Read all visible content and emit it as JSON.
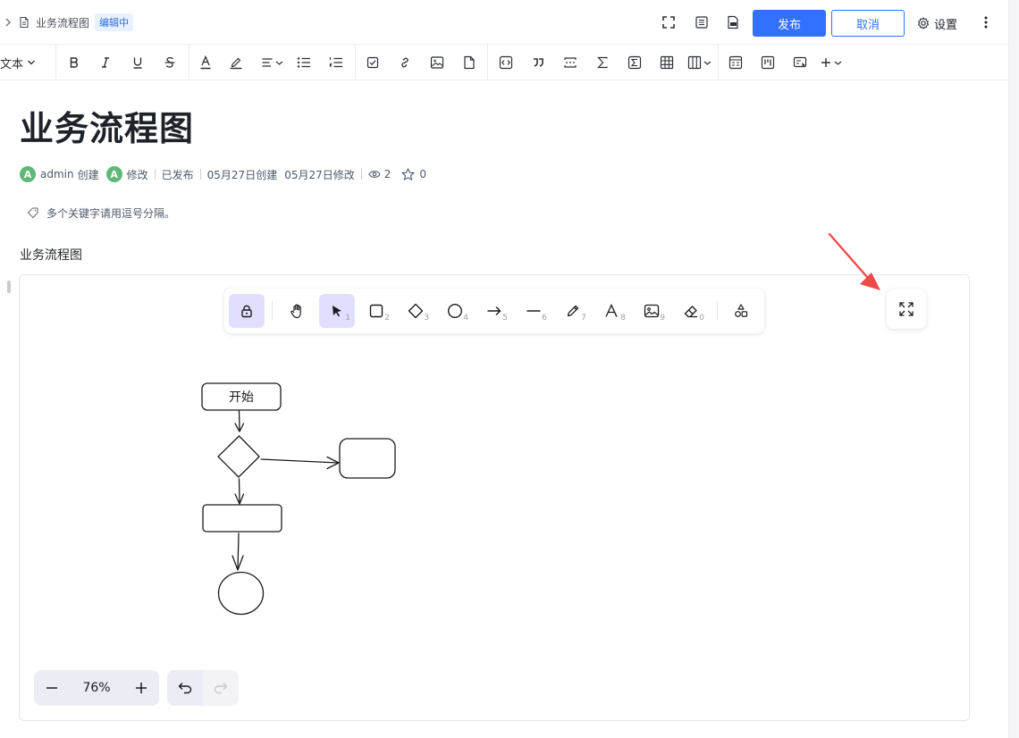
{
  "header": {
    "breadcrumb_title": "业务流程图",
    "status_badge": "编辑中",
    "publish_label": "发布",
    "cancel_label": "取消",
    "settings_label": "设置"
  },
  "toolbar": {
    "text_style_label": "文本",
    "items": [
      "bold-icon",
      "italic-icon",
      "underline-icon",
      "strikethrough-icon",
      "font-color-icon",
      "highlight-icon",
      "align-icon",
      "bullet-list-icon",
      "ordered-list-icon",
      "task-list-icon",
      "link-icon",
      "image-icon",
      "file-icon",
      "code-block-icon",
      "quote-icon",
      "divider-icon",
      "formula-icon",
      "formula-block-icon",
      "table-icon",
      "columns-icon",
      "template-icon",
      "kanban-icon",
      "embed-icon",
      "insert-more-icon"
    ]
  },
  "document": {
    "title": "业务流程图",
    "meta": {
      "avatar_letter": "A",
      "creator": "admin",
      "created_label": "创建",
      "modified_label": "修改",
      "publish_state": "已发布",
      "created_date": "05月27日创建",
      "modified_date": "05月27日修改",
      "views": "2",
      "stars": "0"
    },
    "keywords_placeholder": "多个关键字请用逗号分隔。",
    "section_label": "业务流程图"
  },
  "whiteboard": {
    "tools": [
      {
        "name": "lock-tool",
        "key": ""
      },
      {
        "name": "hand-tool",
        "key": ""
      },
      {
        "name": "select-tool",
        "key": "1"
      },
      {
        "name": "rectangle-tool",
        "key": "2"
      },
      {
        "name": "diamond-tool",
        "key": "3"
      },
      {
        "name": "ellipse-tool",
        "key": "4"
      },
      {
        "name": "arrow-tool",
        "key": "5"
      },
      {
        "name": "line-tool",
        "key": "6"
      },
      {
        "name": "pencil-tool",
        "key": "7"
      },
      {
        "name": "text-tool",
        "key": "8"
      },
      {
        "name": "image-tool",
        "key": "9"
      },
      {
        "name": "eraser-tool",
        "key": "0"
      },
      {
        "name": "shapes-library-tool",
        "key": ""
      }
    ],
    "active_tool": "select-tool",
    "zoom": "76%",
    "flowchart": {
      "start_label": "开始"
    },
    "accent_color": "#e0dfff",
    "annotation_arrow_color": "#ef4a4a"
  },
  "colors": {
    "primary": "#3370ff",
    "avatar": "#5fb878"
  }
}
